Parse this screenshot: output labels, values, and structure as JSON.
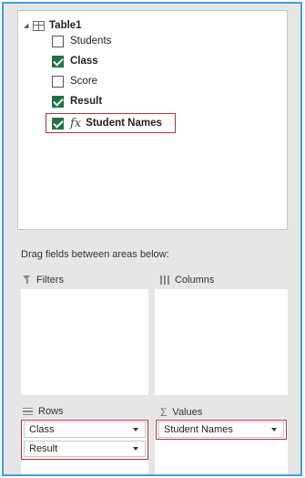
{
  "field_list": {
    "table_name": "Table1",
    "fields": [
      {
        "label": "Students",
        "checked": false
      },
      {
        "label": "Class",
        "checked": true
      },
      {
        "label": "Score",
        "checked": false
      },
      {
        "label": "Result",
        "checked": true
      },
      {
        "label": "Student Names",
        "checked": true,
        "icon": "fx-measure-icon"
      }
    ]
  },
  "hint": "Drag fields between areas below:",
  "areas": {
    "filters": {
      "label": "Filters",
      "icon": "filter-icon"
    },
    "columns": {
      "label": "Columns",
      "icon": "columns-icon"
    },
    "rows": {
      "label": "Rows",
      "icon": "rows-icon",
      "items": [
        "Class",
        "Result"
      ]
    },
    "values": {
      "label": "Values",
      "icon": "sigma-icon",
      "items": [
        "Student Names"
      ]
    }
  },
  "colors": {
    "accent_border": "#3aa0e6",
    "checkbox": "#217346",
    "highlight": "#b4313a"
  }
}
